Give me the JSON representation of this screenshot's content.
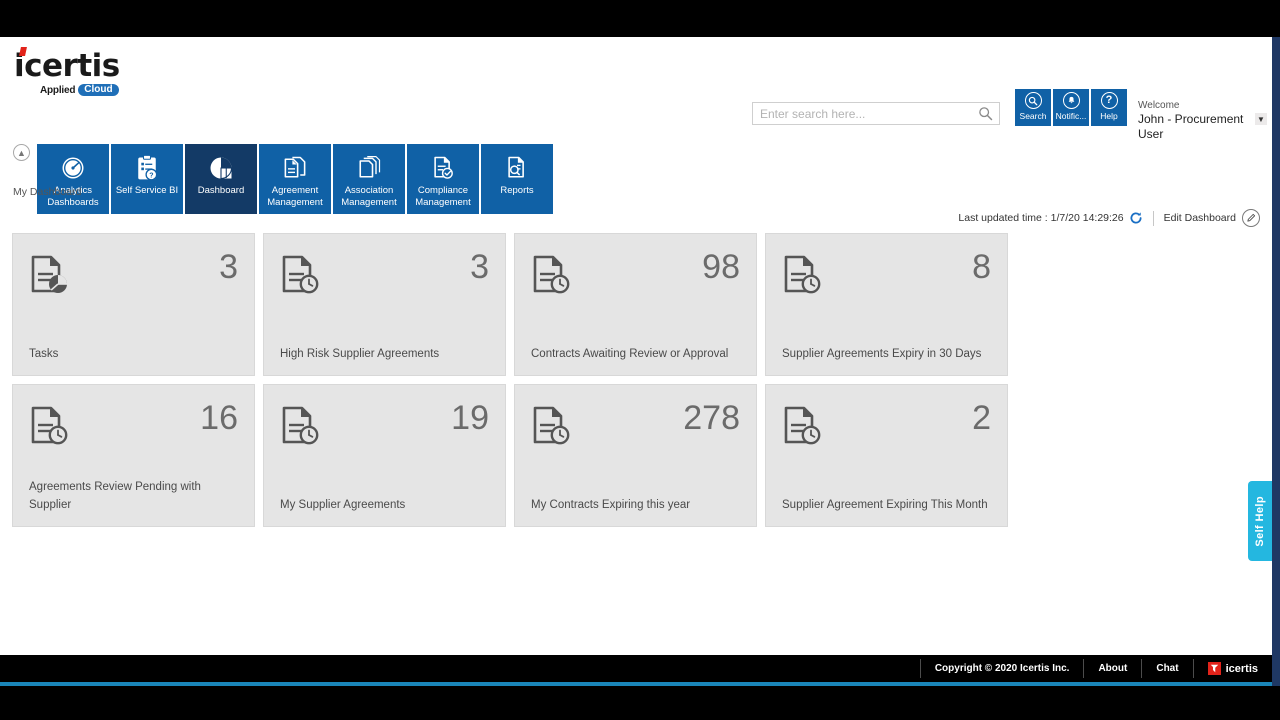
{
  "brand": {
    "name": "icertis",
    "tagline_applied": "Applied",
    "tagline_cloud": "Cloud",
    "accent_red": "#e2231a",
    "accent_blue": "#1061a6",
    "accent_active": "#133a66"
  },
  "search": {
    "placeholder": "Enter search here...",
    "value": "",
    "icon": "search-icon"
  },
  "header_buttons": [
    {
      "label": "Search",
      "icon": "search-icon",
      "glyph": "⌕"
    },
    {
      "label": "Notific...",
      "icon": "bell-icon",
      "glyph": "●"
    },
    {
      "label": "Help",
      "icon": "question-icon",
      "glyph": "?"
    }
  ],
  "user": {
    "greeting": "Welcome",
    "name": "John - Procurement User",
    "caret": "▼"
  },
  "nav": {
    "collapse_icon": "chevron-up-icon",
    "tiles": [
      {
        "label": "Analytics Dashboards",
        "icon": "gauge-icon",
        "active": false
      },
      {
        "label": "Self Service BI",
        "icon": "clipboard-question-icon",
        "active": false
      },
      {
        "label": "Dashboard",
        "icon": "pie-chart-icon",
        "active": true
      },
      {
        "label": "Agreement Management",
        "icon": "documents-icon",
        "active": false
      },
      {
        "label": "Association Management",
        "icon": "copy-documents-icon",
        "active": false
      },
      {
        "label": "Compliance Management",
        "icon": "document-check-icon",
        "active": false
      },
      {
        "label": "Reports",
        "icon": "report-search-icon",
        "active": false
      }
    ]
  },
  "breadcrumb": "My Dashboard",
  "toolbar": {
    "last_updated_label": "Last updated time : 1/7/20 14:29:26",
    "refresh_icon": "refresh-icon",
    "edit_label": "Edit Dashboard",
    "edit_icon": "pencil-icon"
  },
  "cards": [
    {
      "count": "3",
      "title": "Tasks",
      "icon": "document-pie-icon"
    },
    {
      "count": "3",
      "title": "High Risk Supplier Agreements",
      "icon": "document-clock-icon"
    },
    {
      "count": "98",
      "title": "Contracts Awaiting Review or Approval",
      "icon": "document-clock-icon"
    },
    {
      "count": "8",
      "title": "Supplier Agreements Expiry in 30 Days",
      "icon": "document-clock-icon"
    },
    {
      "count": "16",
      "title": "Agreements Review Pending with Supplier",
      "icon": "document-clock-icon"
    },
    {
      "count": "19",
      "title": "My Supplier Agreements",
      "icon": "document-clock-icon"
    },
    {
      "count": "278",
      "title": "My Contracts Expiring this year",
      "icon": "document-clock-icon"
    },
    {
      "count": "2",
      "title": "Supplier Agreement Expiring This Month",
      "icon": "document-clock-icon"
    }
  ],
  "self_help": {
    "label": "Self Help",
    "color": "#24b7e0"
  },
  "footer": {
    "copyright": "Copyright © 2020 Icertis Inc.",
    "about": "About",
    "chat": "Chat",
    "logo_text": "icertis"
  }
}
